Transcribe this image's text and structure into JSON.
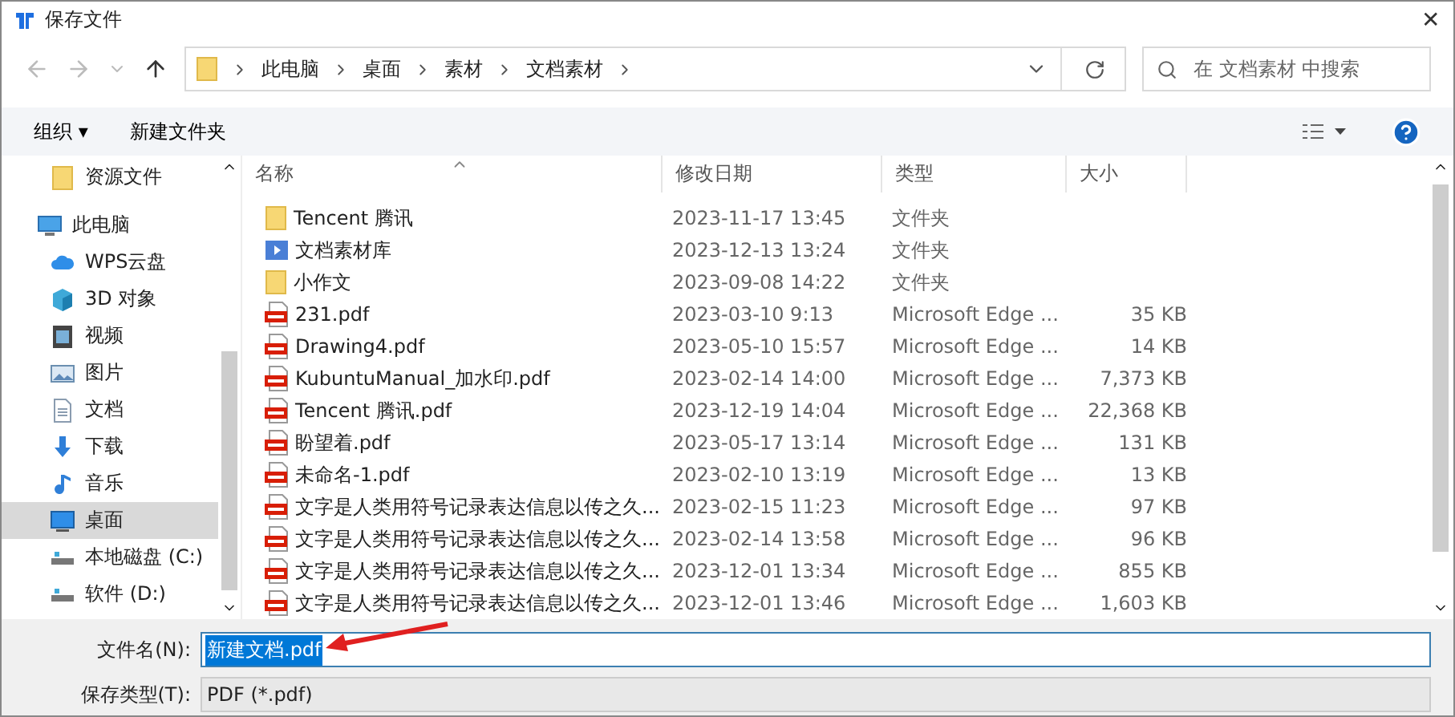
{
  "window": {
    "title": "保存文件",
    "close": "✕"
  },
  "address": {
    "path": [
      "此电脑",
      "桌面",
      "素材",
      "文档素材"
    ],
    "search_placeholder": "在 文档素材 中搜索"
  },
  "toolbar": {
    "organize": "组织 ▾",
    "new_folder": "新建文件夹"
  },
  "sidebar": {
    "items": [
      {
        "label": "资源文件",
        "kind": "folder",
        "selected": false
      },
      {
        "label": "此电脑",
        "kind": "pc",
        "selected": false
      },
      {
        "label": "WPS云盘",
        "kind": "cloud",
        "selected": false
      },
      {
        "label": "3D 对象",
        "kind": "cube",
        "selected": false
      },
      {
        "label": "视频",
        "kind": "video",
        "selected": false
      },
      {
        "label": "图片",
        "kind": "image",
        "selected": false
      },
      {
        "label": "文档",
        "kind": "doc",
        "selected": false
      },
      {
        "label": "下载",
        "kind": "download",
        "selected": false
      },
      {
        "label": "音乐",
        "kind": "music",
        "selected": false
      },
      {
        "label": "桌面",
        "kind": "desktop",
        "selected": true
      },
      {
        "label": "本地磁盘 (C:)",
        "kind": "drive",
        "selected": false
      },
      {
        "label": "软件 (D:)",
        "kind": "drive",
        "selected": false
      }
    ]
  },
  "table": {
    "columns": [
      "名称",
      "修改日期",
      "类型",
      "大小"
    ],
    "rows": [
      {
        "name": "Tencent 腾讯",
        "date": "2023-11-17 13:45",
        "type": "文件夹",
        "size": "",
        "kind": "folder"
      },
      {
        "name": "文档素材库",
        "date": "2023-12-13 13:24",
        "type": "文件夹",
        "size": "",
        "kind": "library"
      },
      {
        "name": "小作文",
        "date": "2023-09-08 14:22",
        "type": "文件夹",
        "size": "",
        "kind": "folder"
      },
      {
        "name": "231.pdf",
        "date": "2023-03-10 9:13",
        "type": "Microsoft Edge ...",
        "size": "35 KB",
        "kind": "pdf"
      },
      {
        "name": "Drawing4.pdf",
        "date": "2023-05-10 15:57",
        "type": "Microsoft Edge ...",
        "size": "14 KB",
        "kind": "pdf"
      },
      {
        "name": "KubuntuManual_加水印.pdf",
        "date": "2023-02-14 14:00",
        "type": "Microsoft Edge ...",
        "size": "7,373 KB",
        "kind": "pdf"
      },
      {
        "name": "Tencent 腾讯.pdf",
        "date": "2023-12-19 14:04",
        "type": "Microsoft Edge ...",
        "size": "22,368 KB",
        "kind": "pdf"
      },
      {
        "name": "盼望着.pdf",
        "date": "2023-05-17 13:14",
        "type": "Microsoft Edge ...",
        "size": "131 KB",
        "kind": "pdf"
      },
      {
        "name": "未命名-1.pdf",
        "date": "2023-02-10 13:19",
        "type": "Microsoft Edge ...",
        "size": "13 KB",
        "kind": "pdf"
      },
      {
        "name": "文字是人类用符号记录表达信息以传之久...",
        "date": "2023-02-15 11:23",
        "type": "Microsoft Edge ...",
        "size": "97 KB",
        "kind": "pdf"
      },
      {
        "name": "文字是人类用符号记录表达信息以传之久...",
        "date": "2023-02-14 13:58",
        "type": "Microsoft Edge ...",
        "size": "96 KB",
        "kind": "pdf"
      },
      {
        "name": "文字是人类用符号记录表达信息以传之久...",
        "date": "2023-12-01 13:34",
        "type": "Microsoft Edge ...",
        "size": "855 KB",
        "kind": "pdf"
      },
      {
        "name": "文字是人类用符号记录表达信息以传之久...",
        "date": "2023-12-01 13:46",
        "type": "Microsoft Edge ...",
        "size": "1,603 KB",
        "kind": "pdf"
      }
    ]
  },
  "form": {
    "filename_label": "文件名(N):",
    "filename": "新建文档.pdf",
    "filename_selected": true,
    "type_label": "保存类型(T):",
    "type_value": "PDF (*.pdf)"
  }
}
